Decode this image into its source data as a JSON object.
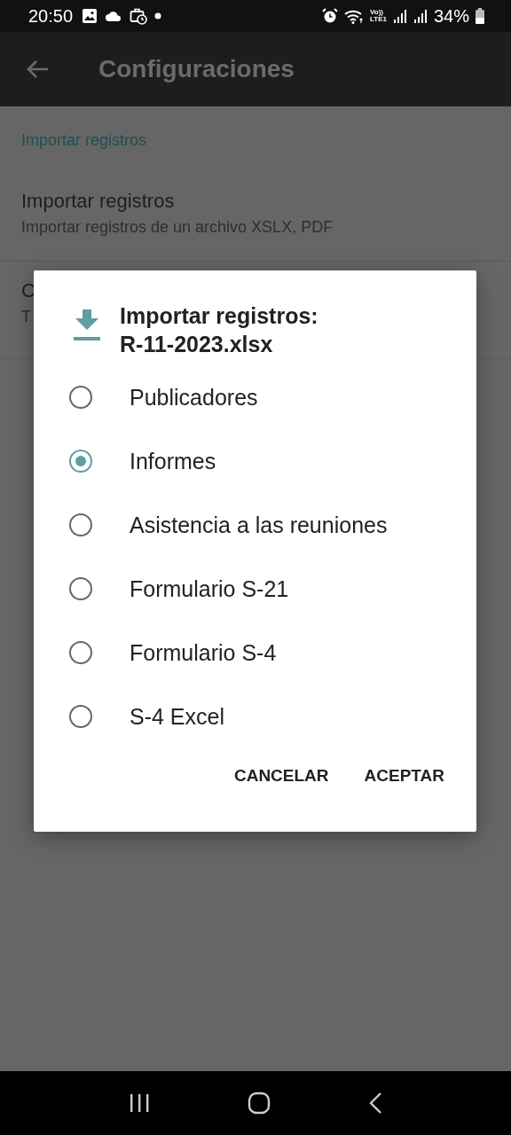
{
  "status_bar": {
    "time": "20:50",
    "volte_label": "Vo))",
    "lte_label": "LTE1",
    "battery_text": "34%"
  },
  "app_bar": {
    "title": "Configuraciones"
  },
  "settings": {
    "section_header": "Importar registros",
    "items": [
      {
        "title": "Importar registros",
        "summary": "Importar registros de un archivo XSLX, PDF"
      },
      {
        "title": "C",
        "summary": "T"
      }
    ]
  },
  "dialog": {
    "title": "Importar registros:",
    "file_name": "R-11-2023.xlsx",
    "options": [
      {
        "label": "Publicadores",
        "selected": false
      },
      {
        "label": "Informes",
        "selected": true
      },
      {
        "label": "Asistencia a las reuniones",
        "selected": false
      },
      {
        "label": "Formulario S-21",
        "selected": false
      },
      {
        "label": "Formulario S-4",
        "selected": false
      },
      {
        "label": "S-4 Excel",
        "selected": false
      }
    ],
    "buttons": [
      "CANCELAR",
      "ACEPTAR"
    ]
  }
}
